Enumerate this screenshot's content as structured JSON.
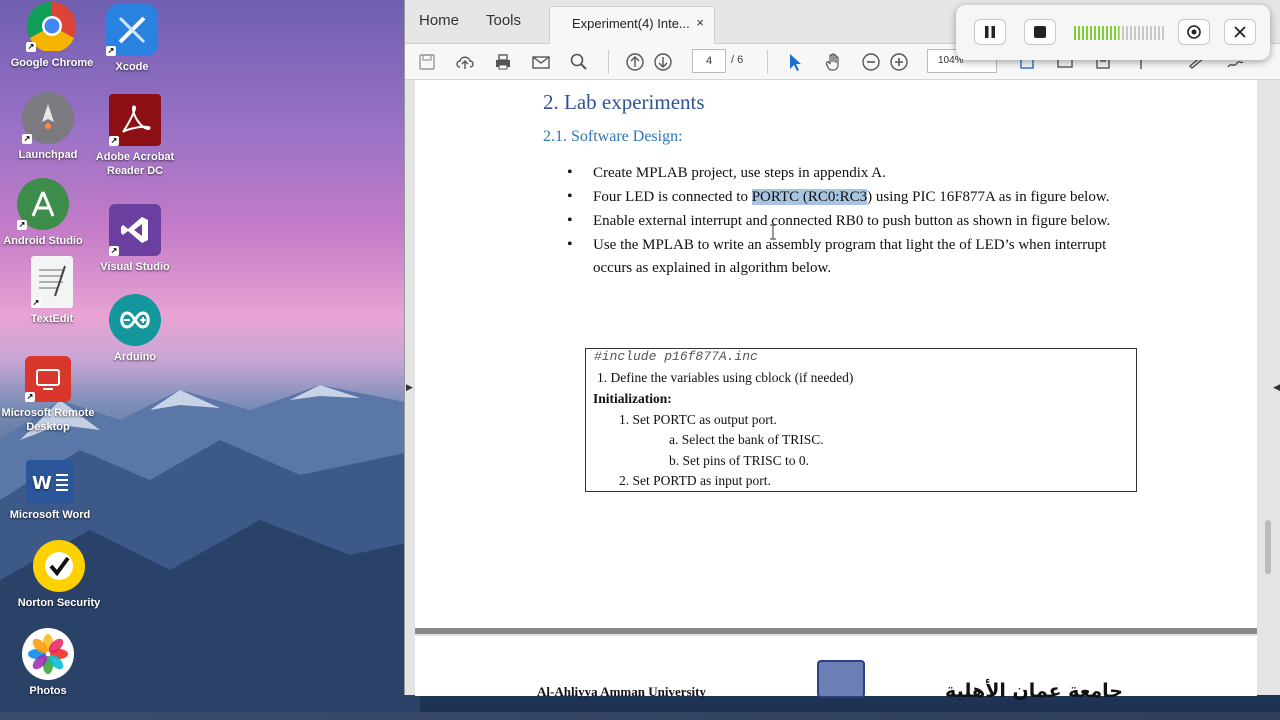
{
  "desktop": {
    "icons": [
      {
        "label": "Google Chrome",
        "icon": "chrome-icon"
      },
      {
        "label": "Xcode",
        "icon": "xcode-icon"
      },
      {
        "label": "Launchpad",
        "icon": "launchpad-icon"
      },
      {
        "label": "Adobe Acrobat Reader DC",
        "icon": "acrobat-icon"
      },
      {
        "label": "Android Studio",
        "icon": "android-studio-icon"
      },
      {
        "label": "Visual Studio",
        "icon": "visual-studio-icon"
      },
      {
        "label": "TextEdit",
        "icon": "textedit-icon"
      },
      {
        "label": "Arduino",
        "icon": "arduino-icon"
      },
      {
        "label": "Microsoft Remote Desktop",
        "icon": "remote-desktop-icon"
      },
      {
        "label": "Microsoft Word",
        "icon": "word-icon"
      },
      {
        "label": "Norton Security",
        "icon": "norton-icon"
      },
      {
        "label": "Photos",
        "icon": "photos-icon"
      }
    ]
  },
  "window": {
    "menu": {
      "home": "Home",
      "tools": "Tools"
    },
    "tab": {
      "title": "Experiment(4) Inte...",
      "close": "×"
    },
    "toolbar": {
      "page_current": "4",
      "page_total": "/ 6",
      "zoom": "104%"
    }
  },
  "document": {
    "heading": "2.  Lab experiments",
    "subheading": "2.1. Software Design:",
    "bullets": [
      {
        "pre": "Create MPLAB project, use steps in appendix A.",
        "hl": "",
        "post": ""
      },
      {
        "pre": "Four LED is connected to ",
        "hl": "PORTC (RC0:RC3",
        "post": ") using PIC 16F877A as in figure below."
      },
      {
        "pre": "Enable external interrupt and connected RB0 to push button as shown in figure below.",
        "hl": "",
        "post": ""
      },
      {
        "pre": "Use the MPLAB to write an assembly program that light the of LED’s when interrupt occurs as explained in algorithm below.",
        "hl": "",
        "post": ""
      }
    ],
    "code": {
      "include": "#include p16f877A.inc",
      "line1": "1.   Define the variables using cblock (if needed)",
      "init": "Initialization:",
      "step1": "1.    Set PORTC as output port.",
      "step1a": "a.    Select the bank of TRISC.",
      "step1b": "b.    Set pins of TRISC to 0.",
      "step2": "2.    Set PORTD as input port."
    },
    "footer": {
      "university_en": "Al-Ahliyya Amman University",
      "university_ar": "جامعة عمان الأهلية"
    }
  },
  "recorder": {
    "level_fraction": 0.5,
    "colors": {
      "level": "#7fcf3c"
    }
  }
}
